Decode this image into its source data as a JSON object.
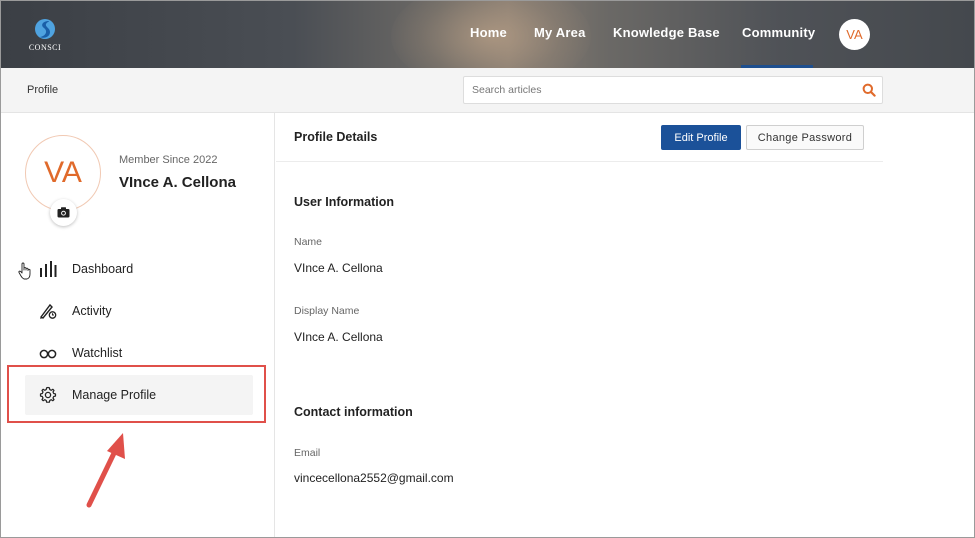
{
  "header": {
    "logo_text": "CONSCI",
    "nav": [
      "Home",
      "My Area",
      "Knowledge Base",
      "Community"
    ],
    "active_nav": "Community",
    "user_initials": "VA"
  },
  "subbar": {
    "breadcrumb": "Profile",
    "search_placeholder": "Search articles"
  },
  "profile": {
    "initials": "VA",
    "member_since": "Member Since 2022",
    "name": "VInce A. Cellona"
  },
  "menu": [
    {
      "label": "Dashboard",
      "icon": "bar-chart-icon"
    },
    {
      "label": "Activity",
      "icon": "pen-clock-icon"
    },
    {
      "label": "Watchlist",
      "icon": "glasses-icon"
    },
    {
      "label": "Manage Profile",
      "icon": "gear-icon"
    }
  ],
  "details": {
    "title": "Profile Details",
    "edit_button": "Edit Profile",
    "password_button": "Change Password",
    "user_info_title": "User Information",
    "name_label": "Name",
    "name_value": "VInce A. Cellona",
    "display_name_label": "Display Name",
    "display_name_value": "VInce A. Cellona",
    "contact_title": "Contact information",
    "email_label": "Email",
    "email_value": "vincecellona2552@gmail.com"
  },
  "colors": {
    "accent_orange": "#e06a2b",
    "primary_blue": "#1b5199",
    "annotation_red": "#e0504a"
  }
}
